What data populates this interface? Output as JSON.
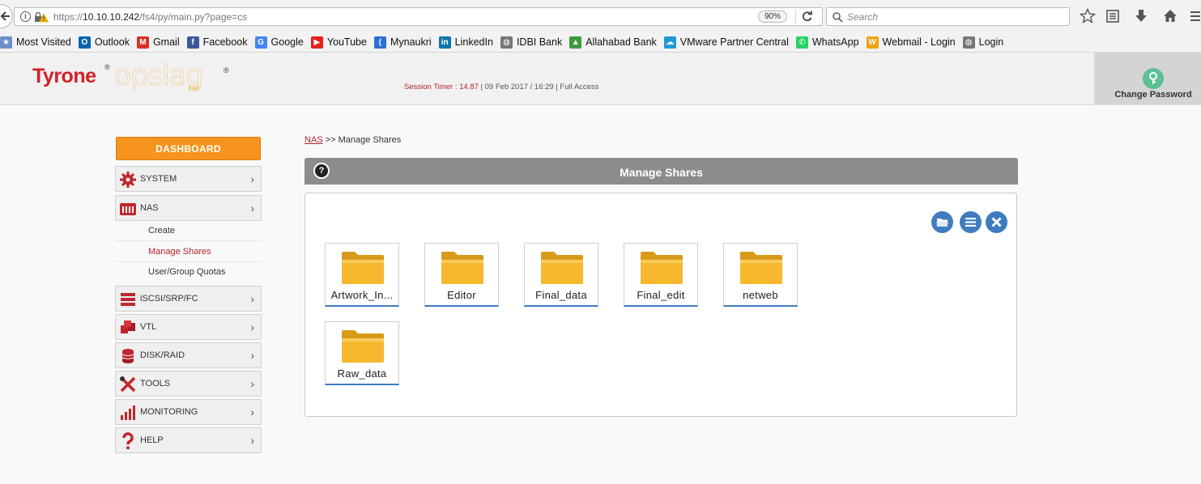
{
  "browser": {
    "url_prefix": "https://",
    "url_host": "10.10.10.242",
    "url_path": "/fs4/py/main.py?page=cs",
    "zoom": "90%",
    "search_placeholder": "Search"
  },
  "bookmarks": [
    {
      "label": "Most Visited",
      "icon": "star-icon",
      "color": "#6a8fc7"
    },
    {
      "label": "Outlook",
      "icon": "outlook-icon",
      "color": "#0a64ad"
    },
    {
      "label": "Gmail",
      "icon": "gmail-icon",
      "color": "#d93025"
    },
    {
      "label": "Facebook",
      "icon": "facebook-icon",
      "color": "#3b5998"
    },
    {
      "label": "Google",
      "icon": "google-icon",
      "color": "#4285f4"
    },
    {
      "label": "YouTube",
      "icon": "youtube-icon",
      "color": "#e62117"
    },
    {
      "label": "Mynaukri",
      "icon": "naukri-icon",
      "color": "#2a6fd6"
    },
    {
      "label": "LinkedIn",
      "icon": "linkedin-icon",
      "color": "#0e76a8"
    },
    {
      "label": "IDBI Bank",
      "icon": "globe-icon",
      "color": "#777777"
    },
    {
      "label": "Allahabad Bank",
      "icon": "allahabad-icon",
      "color": "#3a9b3a"
    },
    {
      "label": "VMware Partner Central",
      "icon": "cloud-icon",
      "color": "#1e9ad6"
    },
    {
      "label": "WhatsApp",
      "icon": "whatsapp-icon",
      "color": "#25d366"
    },
    {
      "label": "Webmail - Login",
      "icon": "webmail-icon",
      "color": "#f0a30a"
    },
    {
      "label": "Login",
      "icon": "globe-icon",
      "color": "#777777"
    }
  ],
  "header": {
    "logo_brand": "Tyrone",
    "logo_product": "opslag",
    "logo_sub": "FS2",
    "logo_reg": "®",
    "session_timer_label": "Session Timer : 14.87",
    "session_rest": " | 09 Feb 2017 / 16:29 | Full Access",
    "change_password": "Change Password"
  },
  "sidebar": {
    "dashboard": "DASHBOARD",
    "items": [
      {
        "label": "SYSTEM",
        "icon": "gear-icon"
      },
      {
        "label": "NAS",
        "icon": "nas-icon"
      },
      {
        "label": "iSCSI/SRP/FC",
        "icon": "server-icon"
      },
      {
        "label": "VTL",
        "icon": "tapes-icon"
      },
      {
        "label": "DISK/RAID",
        "icon": "disk-icon"
      },
      {
        "label": "TOOLS",
        "icon": "tools-icon"
      },
      {
        "label": "MONITORING",
        "icon": "bar-chart-icon"
      },
      {
        "label": "HELP",
        "icon": "question-icon"
      }
    ],
    "nas_sub": [
      "Create",
      "Manage Shares",
      "User/Group Quotas"
    ]
  },
  "main": {
    "breadcrumb_link": "NAS",
    "breadcrumb_rest": " >> Manage Shares",
    "panel_title": "Manage Shares",
    "help_symbol": "?",
    "shares": [
      "Artwork_In...",
      "Editor",
      "Final_data",
      "Final_edit",
      "netweb",
      "Raw_data"
    ]
  },
  "colors": {
    "accent_orange": "#f7941d",
    "brand_red": "#d32027",
    "action_blue": "#3f7cc0",
    "panel_grey": "#8c8c8c"
  }
}
